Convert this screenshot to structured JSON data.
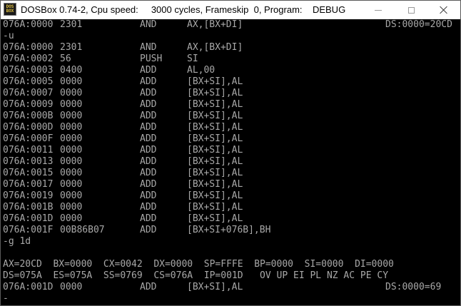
{
  "window": {
    "title": "DOSBox 0.74-2, Cpu speed:     3000 cycles, Frameskip  0, Program:    DEBUG",
    "icon_label_top": "DOS",
    "icon_label_bottom": "BOX",
    "icons": {
      "app": "dosbox-icon",
      "minimize": "minimize-icon",
      "maximize": "maximize-icon",
      "close": "close-icon"
    }
  },
  "console": {
    "rows": [
      {
        "addr": "076A:0000",
        "hex": "2301",
        "op": "AND",
        "arg": "AX,[BX+DI]",
        "right": "DS:0000=20CD"
      },
      {
        "text": "-u"
      },
      {
        "addr": "076A:0000",
        "hex": "2301",
        "op": "AND",
        "arg": "AX,[BX+DI]"
      },
      {
        "addr": "076A:0002",
        "hex": "56",
        "op": "PUSH",
        "arg": "SI"
      },
      {
        "addr": "076A:0003",
        "hex": "0400",
        "op": "ADD",
        "arg": "AL,00"
      },
      {
        "addr": "076A:0005",
        "hex": "0000",
        "op": "ADD",
        "arg": "[BX+SI],AL"
      },
      {
        "addr": "076A:0007",
        "hex": "0000",
        "op": "ADD",
        "arg": "[BX+SI],AL"
      },
      {
        "addr": "076A:0009",
        "hex": "0000",
        "op": "ADD",
        "arg": "[BX+SI],AL"
      },
      {
        "addr": "076A:000B",
        "hex": "0000",
        "op": "ADD",
        "arg": "[BX+SI],AL"
      },
      {
        "addr": "076A:000D",
        "hex": "0000",
        "op": "ADD",
        "arg": "[BX+SI],AL"
      },
      {
        "addr": "076A:000F",
        "hex": "0000",
        "op": "ADD",
        "arg": "[BX+SI],AL"
      },
      {
        "addr": "076A:0011",
        "hex": "0000",
        "op": "ADD",
        "arg": "[BX+SI],AL"
      },
      {
        "addr": "076A:0013",
        "hex": "0000",
        "op": "ADD",
        "arg": "[BX+SI],AL"
      },
      {
        "addr": "076A:0015",
        "hex": "0000",
        "op": "ADD",
        "arg": "[BX+SI],AL"
      },
      {
        "addr": "076A:0017",
        "hex": "0000",
        "op": "ADD",
        "arg": "[BX+SI],AL"
      },
      {
        "addr": "076A:0019",
        "hex": "0000",
        "op": "ADD",
        "arg": "[BX+SI],AL"
      },
      {
        "addr": "076A:001B",
        "hex": "0000",
        "op": "ADD",
        "arg": "[BX+SI],AL"
      },
      {
        "addr": "076A:001D",
        "hex": "0000",
        "op": "ADD",
        "arg": "[BX+SI],AL"
      },
      {
        "addr": "076A:001F",
        "hex": "00B86B07",
        "op": "ADD",
        "arg": "[BX+SI+076B],BH"
      },
      {
        "text": "-g 1d"
      },
      {
        "text": ""
      },
      {
        "text": "AX=20CD  BX=0000  CX=0042  DX=0000  SP=FFFE  BP=0000  SI=0000  DI=0000"
      },
      {
        "text": "DS=075A  ES=075A  SS=0769  CS=076A  IP=001D   OV UP EI PL NZ AC PE CY"
      },
      {
        "addr": "076A:001D",
        "hex": "0000",
        "op": "ADD",
        "arg": "[BX+SI],AL",
        "right": "DS:0000=69"
      },
      {
        "text": "-"
      }
    ]
  }
}
